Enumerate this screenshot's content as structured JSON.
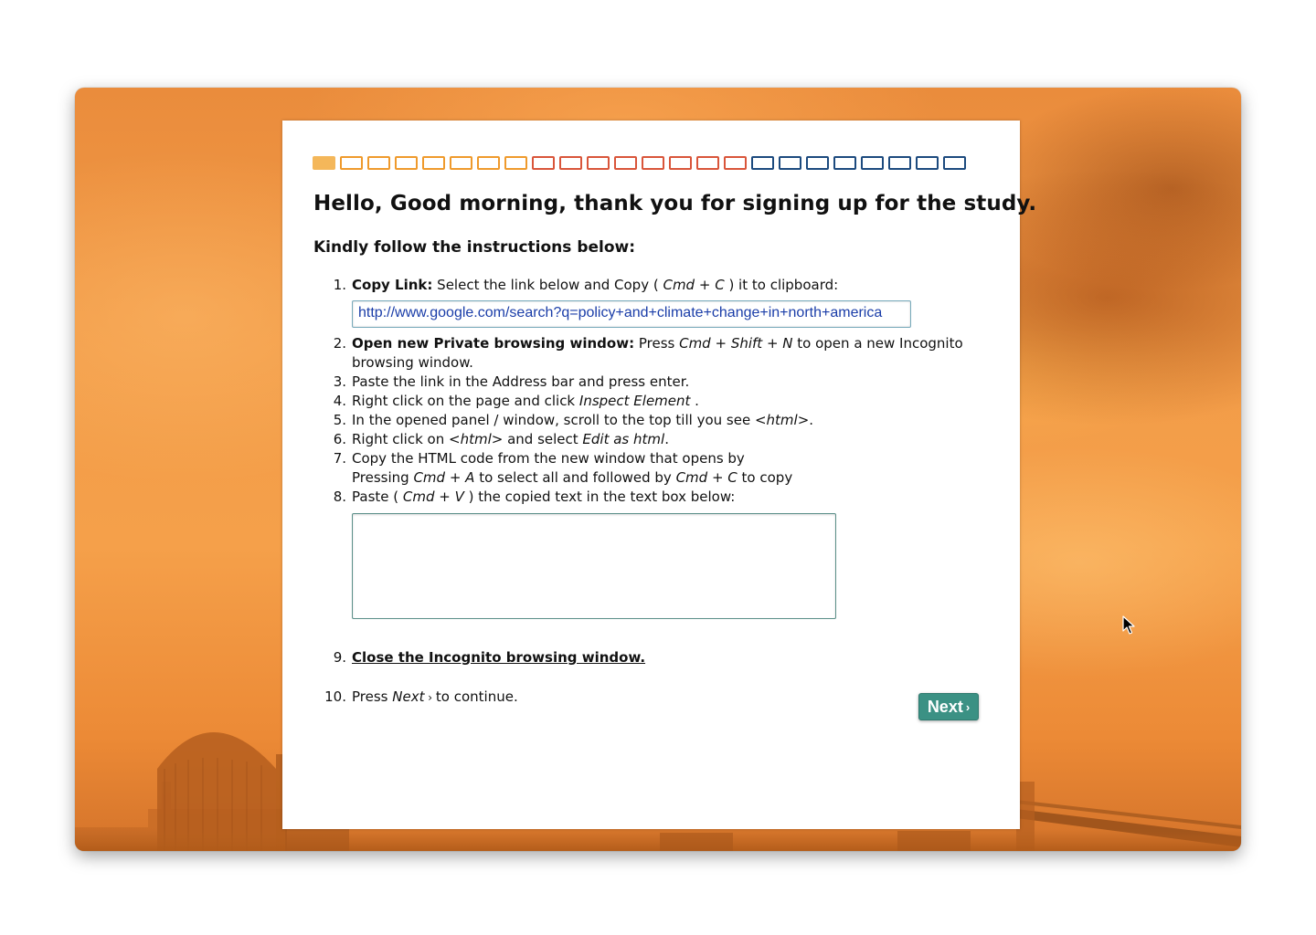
{
  "progress": {
    "colors": [
      "#f4b75a",
      "#ef9a2c",
      "#ef9a2c",
      "#ef9a2c",
      "#ef9a2c",
      "#ef9a2c",
      "#ef9a2c",
      "#ef9a2c",
      "#d9553a",
      "#d9553a",
      "#d9553a",
      "#d9553a",
      "#d9553a",
      "#d9553a",
      "#d9553a",
      "#d9553a",
      "#1c4a7e",
      "#1c4a7e",
      "#1c4a7e",
      "#1c4a7e",
      "#1c4a7e",
      "#1c4a7e",
      "#1c4a7e",
      "#1c4a7e"
    ],
    "current": 1
  },
  "heading": "Hello, Good morning, thank you for signing up for the study.",
  "subheading": "Kindly follow the instructions below:",
  "steps": {
    "s1": {
      "num": "1.",
      "bold": "Copy Link:",
      "text_a": " Select the link below and Copy ( ",
      "key_a": "Cmd",
      "plus": " + ",
      "key_b": "C",
      "text_b": " ) it to clipboard:"
    },
    "link_value": "http://www.google.com/search?q=policy+and+climate+change+in+north+america",
    "s2": {
      "num": "2.",
      "bold": "Open new Private browsing window:",
      "text_a": " Press ",
      "key_a": "Cmd",
      "plus": " + ",
      "key_b": "Shift",
      "plus2": " + ",
      "key_c": "N",
      "text_b": " to open a new Incognito",
      "text_c": "browsing window."
    },
    "s3": {
      "num": "3.",
      "text": "Paste the link in the Address bar and press enter."
    },
    "s4": {
      "num": "4.",
      "text_a": "Right click on the page and click ",
      "ital": "Inspect Element",
      "text_b": " ."
    },
    "s5": {
      "num": "5.",
      "text_a": "In the opened panel / window, scroll to the top till you see ",
      "ital": "<html>",
      "text_b": "."
    },
    "s6": {
      "num": "6.",
      "text_a": "Right click on ",
      "ital_a": "<html>",
      "text_b": " and select ",
      "ital_b": "Edit as html",
      "text_c": "."
    },
    "s7": {
      "num": "7.",
      "text_a": "Copy the HTML code from the new window that opens by",
      "text_b": "Pressing ",
      "key_a": "Cmd",
      "plus": " + ",
      "key_b": "A",
      "text_c": " to select all and followed by ",
      "key_c": "Cmd",
      "plus2": " + ",
      "key_d": "C",
      "text_d": " to copy"
    },
    "s8": {
      "num": "8.",
      "text_a": "Paste ( ",
      "key_a": "Cmd",
      "plus": " + ",
      "key_b": "V",
      "text_b": " ) the copied text in the text box below:"
    },
    "paste_value": "",
    "s9": {
      "num": "9.",
      "link": "Close the Incognito browsing window."
    },
    "s10": {
      "num": "10.",
      "text_a": "Press ",
      "ital": "Next",
      "chev": " › ",
      "text_b": "to continue."
    }
  },
  "next_button": {
    "label": "Next",
    "chevron": "›",
    "color": "#3b9184"
  },
  "icons": {
    "cursor": "mouse-pointer-icon"
  }
}
